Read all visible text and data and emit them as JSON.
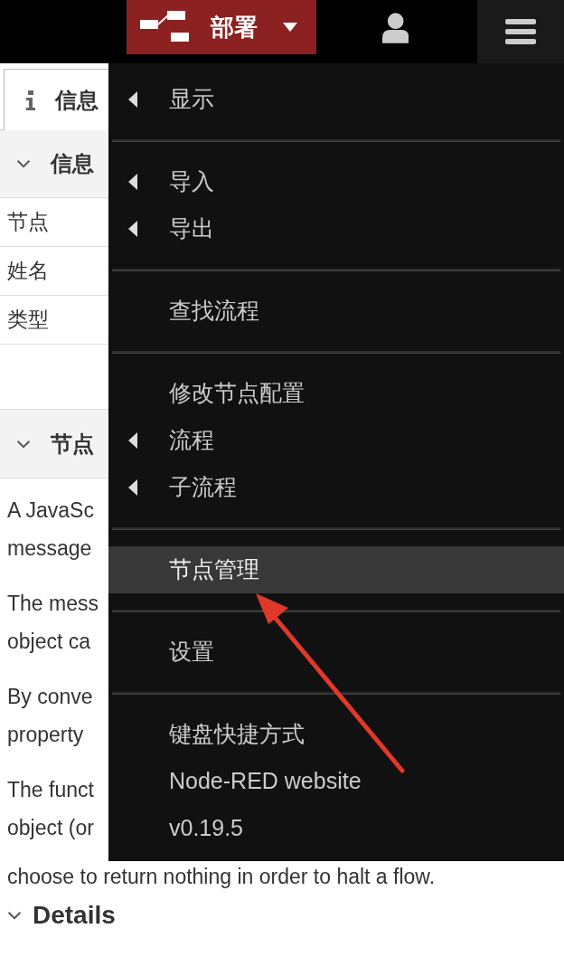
{
  "header": {
    "deploy_label": "部署"
  },
  "sidebar": {
    "tab": {
      "label": "信息",
      "selected": true
    },
    "info_section": {
      "title": "信息",
      "expanded": true,
      "rows": [
        "节点",
        "姓名",
        "类型"
      ]
    },
    "help_section": {
      "title": "节点",
      "expanded": true
    },
    "help_lines": [
      [
        "A JavaSc",
        "message"
      ],
      [
        "The mess",
        "object ca"
      ],
      [
        "By conve",
        "property"
      ],
      [
        "The funct",
        "object (or",
        "choose to return nothing in order to halt a flow."
      ]
    ],
    "details": {
      "title": "Details",
      "expanded": true
    }
  },
  "menu": {
    "sections": [
      [
        {
          "label": "显示",
          "submenu": true,
          "selected": false
        }
      ],
      [
        {
          "label": "导入",
          "submenu": true,
          "selected": false
        },
        {
          "label": "导出",
          "submenu": true,
          "selected": false
        }
      ],
      [
        {
          "label": "查找流程",
          "submenu": false,
          "selected": false
        }
      ],
      [
        {
          "label": "修改节点配置",
          "submenu": false,
          "selected": false
        },
        {
          "label": "流程",
          "submenu": true,
          "selected": false
        },
        {
          "label": "子流程",
          "submenu": true,
          "selected": false
        }
      ],
      [
        {
          "label": "节点管理",
          "submenu": false,
          "selected": true
        }
      ],
      [
        {
          "label": "设置",
          "submenu": false,
          "selected": false
        }
      ],
      [
        {
          "label": "键盘快捷方式",
          "submenu": false,
          "selected": false
        },
        {
          "label": "Node-RED website",
          "submenu": false,
          "selected": false
        },
        {
          "label": "v0.19.5",
          "submenu": false,
          "selected": false
        }
      ]
    ]
  }
}
